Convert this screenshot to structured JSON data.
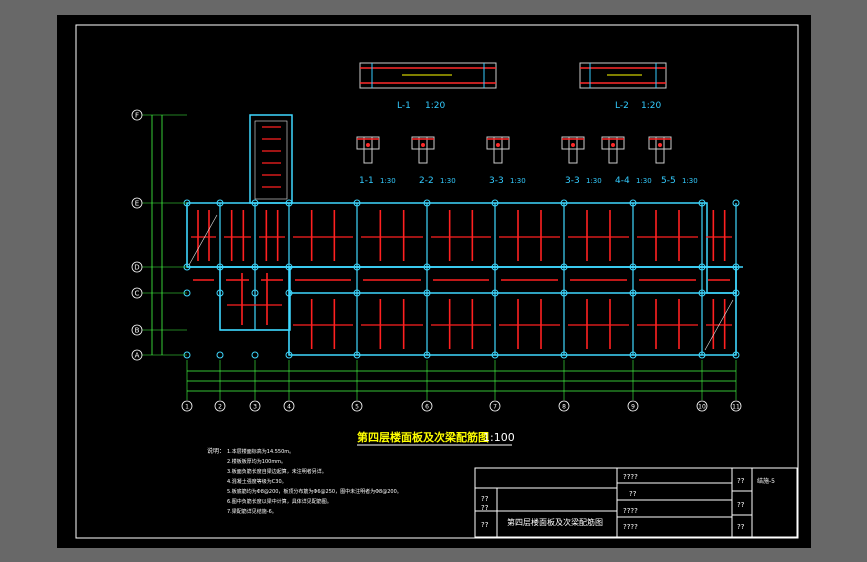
{
  "drawing": {
    "plan_title": "第四层楼面板及次梁配筋图",
    "plan_scale": "1:100",
    "grid_rows": [
      "F",
      "E",
      "D",
      "C",
      "B",
      "A"
    ],
    "grid_cols": [
      "1",
      "2",
      "3",
      "4",
      "5",
      "6",
      "7",
      "8",
      "9",
      "10",
      "11"
    ],
    "beam_sections": [
      {
        "label": "L-1",
        "scale": "1:20"
      },
      {
        "label": "L-2",
        "scale": "1:20"
      }
    ],
    "details": [
      {
        "label": "1-1",
        "scale": "1:30"
      },
      {
        "label": "2-2",
        "scale": "1:30"
      },
      {
        "label": "3-3",
        "scale": "1:30"
      },
      {
        "label": "3-3",
        "scale": "1:30"
      },
      {
        "label": "4-4",
        "scale": "1:30"
      },
      {
        "label": "5-5",
        "scale": "1:30"
      }
    ],
    "notes_heading": "说明：",
    "notes": [
      "1.本层楼面标高为14.550m。",
      "2.楼板板厚均为100mm。",
      "3.板面负筋长度自梁边起算，未注明者另详。",
      "4.混凝土强度等级为C30。",
      "5.板底筋均为Φ8@200，板顶分布筋为Φ6@250，图中未注明者为Φ8@200。",
      "6.图中负筋长度以梁中计算，具体详见配筋图。",
      "7.梁配筋详见结施-6。"
    ]
  },
  "title_block": {
    "drawing_name": "第四层楼面板及次梁配筋图",
    "drawing_no": "结施-5",
    "c1": "??",
    "c2": "??",
    "c3": "??",
    "m1": "????",
    "m2": "??",
    "m3": "????",
    "m4": "????",
    "r1": "??",
    "r2": "??",
    "r3": "??"
  }
}
